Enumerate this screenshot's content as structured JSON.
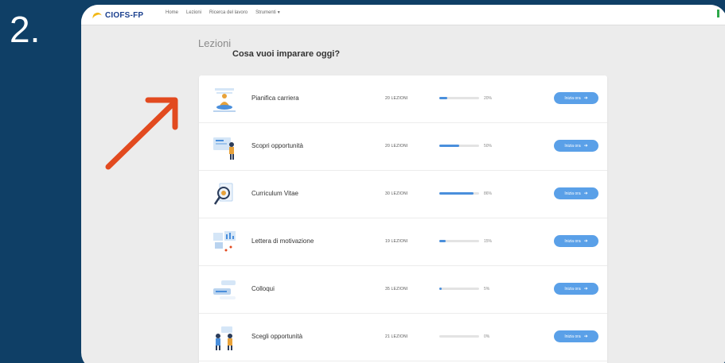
{
  "step": {
    "number": "2."
  },
  "topnav": {
    "logo": "CIOFS-FP",
    "links": [
      "Home",
      "Lezioni",
      "Ricerca del lavoro",
      "Strumenti"
    ],
    "dropdown_icon": "caret-down-icon"
  },
  "page": {
    "section_label": "Lezioni",
    "title": "Cosa vuoi imparare oggi?"
  },
  "lessons": [
    {
      "title": "Pianifica carriera",
      "count": "20 LEZIONI",
      "progress": 20,
      "progress_label": "20%",
      "button": "Inizia ora",
      "icon": "meditation-person-icon"
    },
    {
      "title": "Scopri opportunità",
      "count": "20 LEZIONI",
      "progress": 50,
      "progress_label": "50%",
      "button": "Inizia ora",
      "icon": "person-at-board-icon"
    },
    {
      "title": "Curriculum Vitae",
      "count": "30 LEZIONI",
      "progress": 86,
      "progress_label": "86%",
      "button": "Inizia ora",
      "icon": "magnifier-document-icon"
    },
    {
      "title": "Lettera di motivazione",
      "count": "19 LEZIONI",
      "progress": 15,
      "progress_label": "15%",
      "button": "Inizia ora",
      "icon": "charts-board-icon"
    },
    {
      "title": "Colloqui",
      "count": "35 LEZIONI",
      "progress": 5,
      "progress_label": "5%",
      "button": "Inizia ora",
      "icon": "chat-conversation-icon"
    },
    {
      "title": "Scegli opportunità",
      "count": "21 LEZIONI",
      "progress": 0,
      "progress_label": "0%",
      "button": "Inizia ora",
      "icon": "people-choosing-icon"
    }
  ],
  "colors": {
    "background": "#0f3f66",
    "accent_button": "#5aa0e8",
    "progress": "#4a8fdc",
    "arrow": "#e24a1f"
  }
}
